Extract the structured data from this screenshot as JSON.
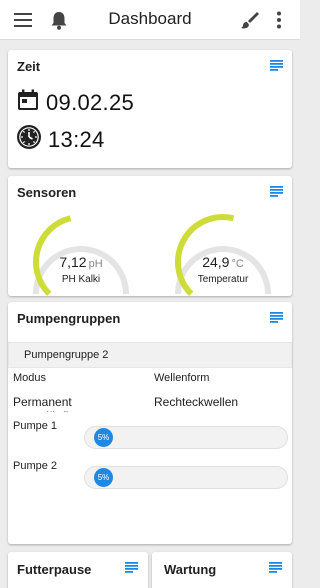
{
  "app": {
    "title": "Dashboard",
    "accent": "#1e88e5",
    "gauge_color": "#cddc39",
    "icons": [
      "menu-icon",
      "bell-icon",
      "brush-icon",
      "more-vertical-icon"
    ]
  },
  "zeit": {
    "title": "Zeit",
    "date": "09.02.25",
    "time": "13:24",
    "icons": [
      "calendar-icon",
      "clock-icon"
    ]
  },
  "sensoren": {
    "title": "Sensoren",
    "gauges": [
      {
        "value": "7,12",
        "unit": "pH",
        "label": "PH Kalki",
        "fill": 0.45
      },
      {
        "value": "24,9",
        "unit": "°C",
        "label": "Temperatur",
        "fill": 0.55
      }
    ]
  },
  "pumpen": {
    "title": "Pumpengruppen",
    "group": "Pumpengruppe 2",
    "modus_label": "Modus",
    "modus_value": "Permanent gegenläufig",
    "wellenform_label": "Wellenform",
    "wellenform_value": "Rechteckwellen",
    "pumps": [
      {
        "label": "Pumpe 1",
        "percent": "5%",
        "value": 0.05
      },
      {
        "label": "Pumpe 2",
        "percent": "5%",
        "value": 0.05
      }
    ]
  },
  "futterpause": {
    "title": "Futterpause"
  },
  "wartung": {
    "title": "Wartung"
  }
}
